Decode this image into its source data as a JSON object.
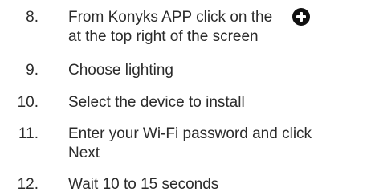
{
  "steps": [
    {
      "number": "8.",
      "line1": "From Konyks APP click on the",
      "line2": "at the top right of the screen",
      "icon": "plus-circle-icon"
    },
    {
      "number": "9.",
      "line1": "Choose lighting"
    },
    {
      "number": "10.",
      "line1": "Select the device to install"
    },
    {
      "number": "11.",
      "line1": "Enter your Wi-Fi password and click",
      "line2": "Next"
    },
    {
      "number": "12.",
      "line1": "Wait 10 to 15 seconds"
    }
  ],
  "colors": {
    "text": "#2b2b2b",
    "icon": "#111111",
    "background": "#ffffff"
  }
}
